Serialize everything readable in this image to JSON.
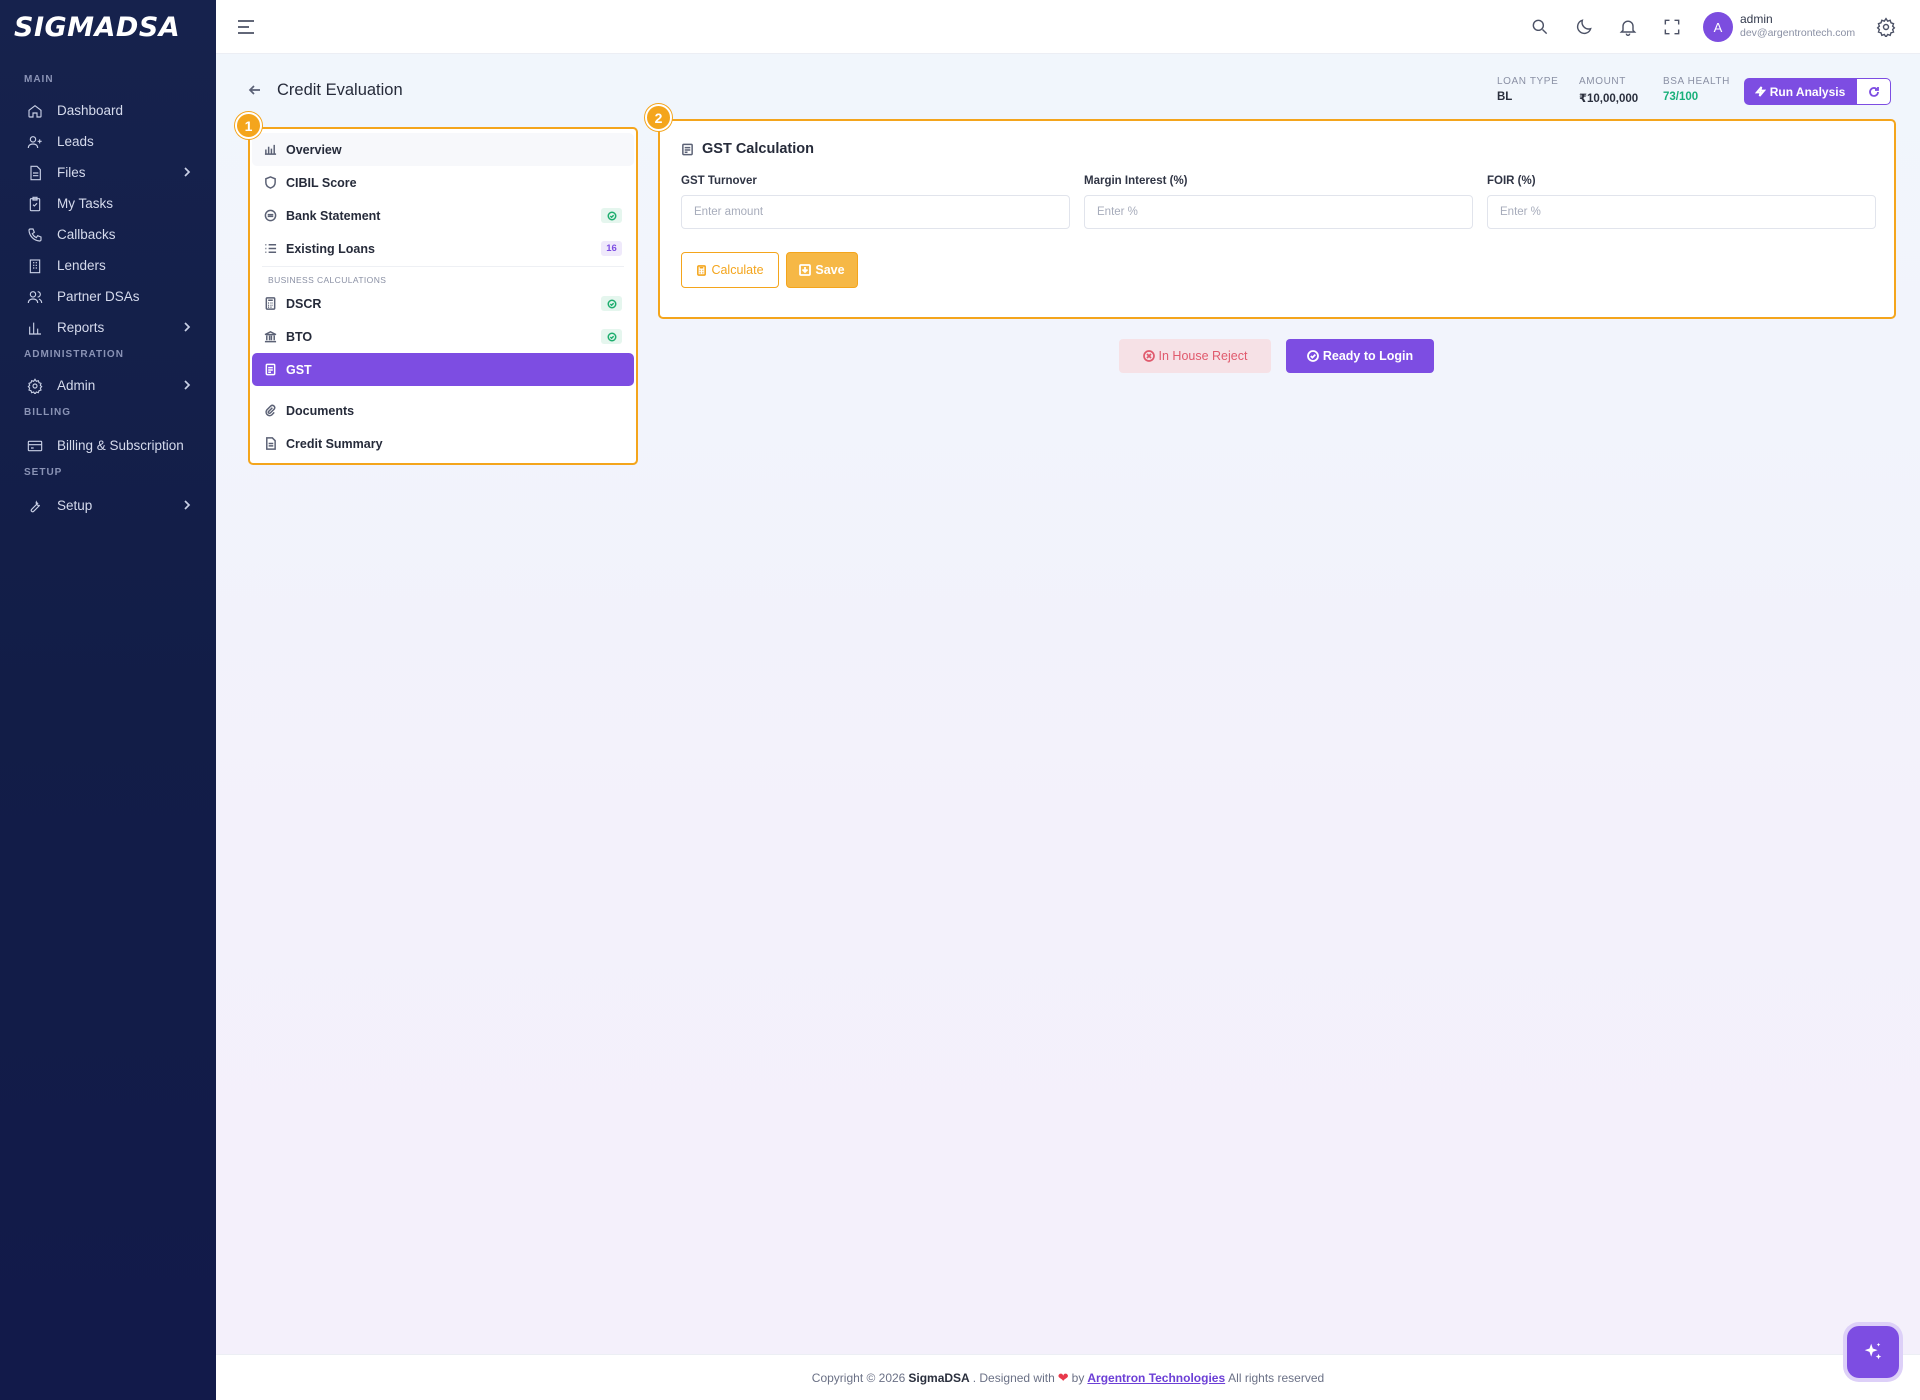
{
  "brand": {
    "logo_text": "SIGMADSA"
  },
  "sidebar": {
    "sections": [
      {
        "title": "MAIN"
      },
      {
        "title": "ADMINISTRATION"
      },
      {
        "title": "BILLING"
      },
      {
        "title": "SETUP"
      }
    ],
    "items": {
      "dashboard": "Dashboard",
      "leads": "Leads",
      "files": "Files",
      "my_tasks": "My Tasks",
      "callbacks": "Callbacks",
      "lenders": "Lenders",
      "partner_dsas": "Partner DSAs",
      "reports": "Reports",
      "admin": "Admin",
      "billing": "Billing & Subscription",
      "setup": "Setup"
    }
  },
  "topbar": {
    "avatar_initial": "A",
    "user_name": "admin",
    "user_email": "dev@argentrontech.com",
    "icons": [
      "menu-icon",
      "search-icon",
      "moon-icon",
      "bell-icon",
      "fullscreen-icon",
      "gear-icon"
    ]
  },
  "header": {
    "title": "Credit Evaluation",
    "meta": [
      {
        "label": "LOAN TYPE",
        "value": "BL"
      },
      {
        "label": "AMOUNT",
        "value": "₹10,00,000"
      },
      {
        "label": "BSA HEALTH",
        "value": "73/100"
      }
    ],
    "run_analysis": "Run Analysis"
  },
  "steps": {
    "left": "1",
    "right": "2"
  },
  "left_nav": {
    "overview": "Overview",
    "cibil": "CIBIL Score",
    "bank_statement": "Bank Statement",
    "existing_loans": "Existing Loans",
    "existing_loans_count": "16",
    "section_business": "BUSINESS CALCULATIONS",
    "dscr": "DSCR",
    "bto": "BTO",
    "gst": "GST",
    "documents": "Documents",
    "credit_summary": "Credit Summary"
  },
  "gst": {
    "title": "GST Calculation",
    "fields": [
      {
        "label": "GST Turnover",
        "placeholder": "Enter amount",
        "value": ""
      },
      {
        "label": "Margin Interest (%)",
        "placeholder": "Enter %",
        "value": ""
      },
      {
        "label": "FOIR (%)",
        "placeholder": "Enter %",
        "value": ""
      }
    ],
    "calculate": "Calculate",
    "save": "Save"
  },
  "actions": {
    "reject": "In House Reject",
    "ready": "Ready to Login"
  },
  "footer": {
    "prefix": "Copyright © 2026",
    "brand": "SigmaDSA",
    "mid": ". Designed with",
    "heart": "❤",
    "by": "by",
    "company": "Argentron Technologies",
    "suffix": "All rights reserved"
  },
  "colors": {
    "accent": "#7d4de2",
    "highlight": "#f4a51c",
    "success": "#19b07a",
    "danger": "#e05a6d",
    "sidebar": "#16224d"
  }
}
